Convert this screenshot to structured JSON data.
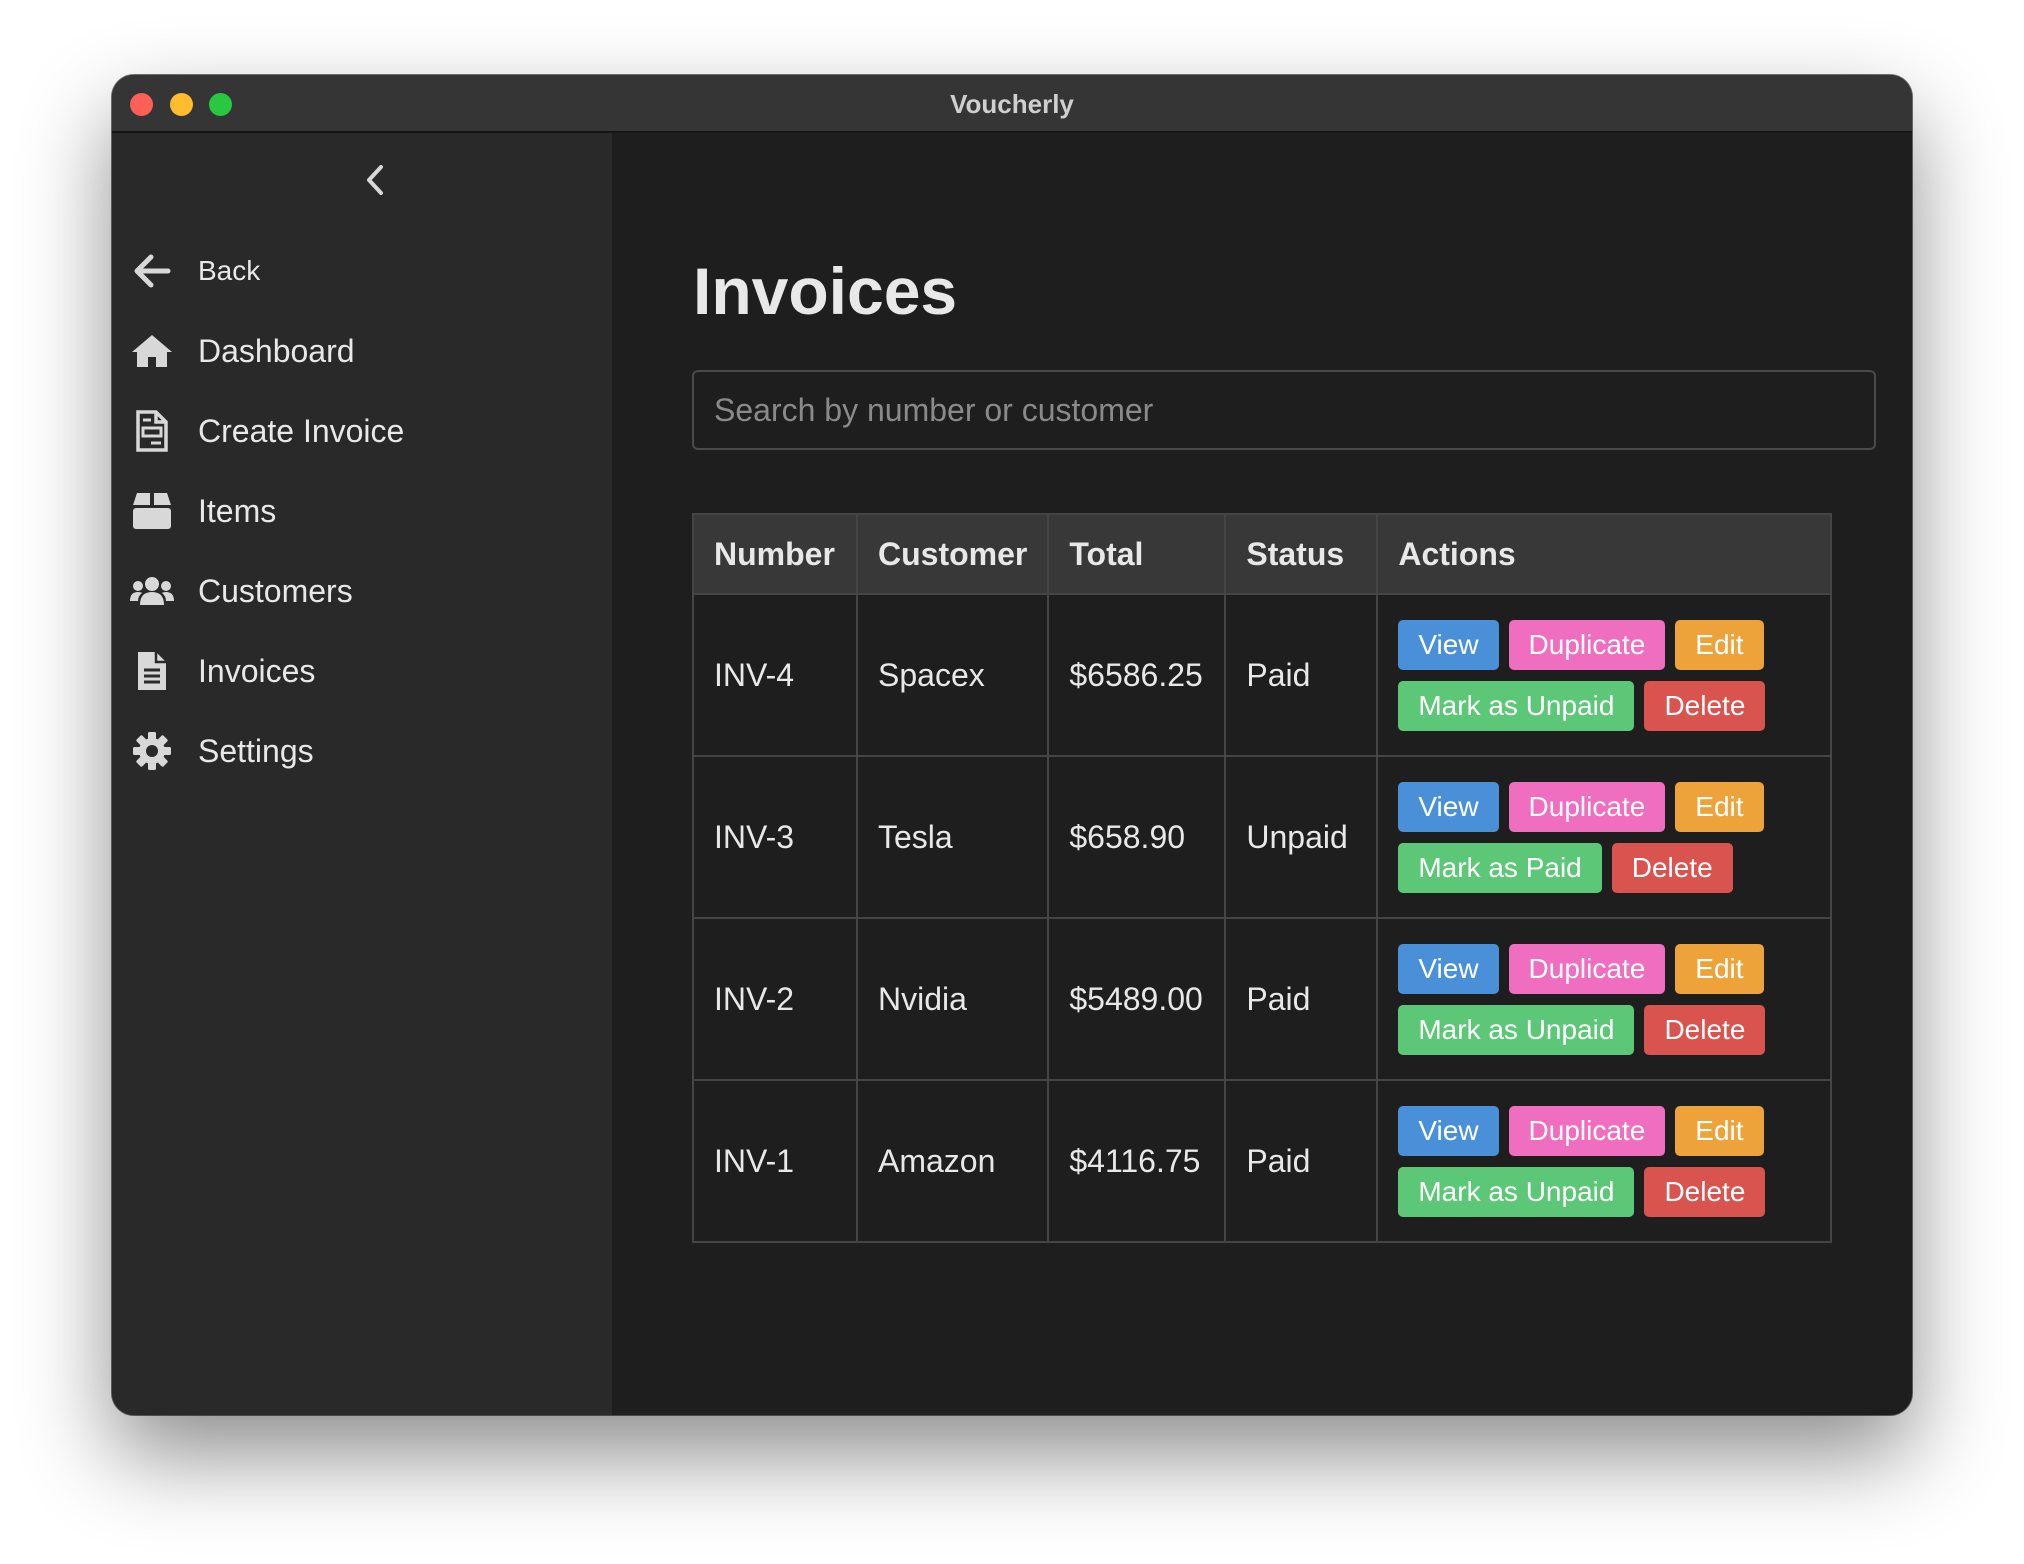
{
  "window": {
    "title": "Voucherly"
  },
  "sidebar": {
    "back_label": "Back",
    "items": [
      {
        "label": "Dashboard",
        "icon": "home-icon"
      },
      {
        "label": "Create Invoice",
        "icon": "invoice-form-icon"
      },
      {
        "label": "Items",
        "icon": "box-icon"
      },
      {
        "label": "Customers",
        "icon": "users-icon"
      },
      {
        "label": "Invoices",
        "icon": "document-icon"
      },
      {
        "label": "Settings",
        "icon": "gear-icon"
      }
    ]
  },
  "main": {
    "title": "Invoices",
    "search_placeholder": "Search by number or customer",
    "table": {
      "headers": [
        "Number",
        "Customer",
        "Total",
        "Status",
        "Actions"
      ],
      "rows": [
        {
          "number": "INV-4",
          "customer": "Spacex",
          "total": "$6586.25",
          "status": "Paid",
          "mark_label": "Mark as Unpaid"
        },
        {
          "number": "INV-3",
          "customer": "Tesla",
          "total": "$658.90",
          "status": "Unpaid",
          "mark_label": "Mark as Paid"
        },
        {
          "number": "INV-2",
          "customer": "Nvidia",
          "total": "$5489.00",
          "status": "Paid",
          "mark_label": "Mark as Unpaid"
        },
        {
          "number": "INV-1",
          "customer": "Amazon",
          "total": "$4116.75",
          "status": "Paid",
          "mark_label": "Mark as Unpaid"
        }
      ]
    },
    "actions": {
      "view": "View",
      "duplicate": "Duplicate",
      "edit": "Edit",
      "delete": "Delete"
    }
  },
  "colors": {
    "view": "#4a90d9",
    "duplicate": "#f06ec0",
    "edit": "#eea33a",
    "mark": "#5cc877",
    "delete": "#d9534f"
  }
}
